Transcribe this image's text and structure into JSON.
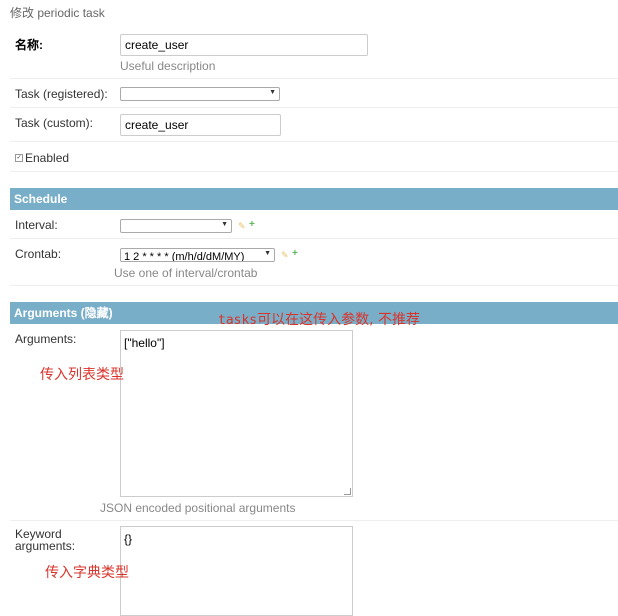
{
  "page": {
    "title": "修改 periodic task"
  },
  "fields": {
    "name": {
      "label": "名称:",
      "value": "create_user",
      "help": "Useful description"
    },
    "task_registered": {
      "label": "Task (registered):",
      "value": ""
    },
    "task_custom": {
      "label": "Task (custom):",
      "value": "create_user"
    },
    "enabled": {
      "label": "Enabled",
      "checked": true
    }
  },
  "schedule": {
    "title": "Schedule",
    "interval": {
      "label": "Interval:",
      "value": ""
    },
    "crontab": {
      "label": "Crontab:",
      "value": "1 2 * * * * (m/h/d/dM/MY)",
      "help": "Use one of interval/crontab"
    }
  },
  "arguments_section": {
    "title": "Arguments (隐藏)",
    "arguments": {
      "label": "Arguments:",
      "value": "[\"hello\"]",
      "help": "JSON encoded positional arguments"
    },
    "kwargs": {
      "label_line1": "Keyword",
      "label_line2": "arguments:",
      "value": "{}"
    }
  },
  "annotations": {
    "tasks_prefix": "tasks",
    "tasks_note": "可以在这传入参数, 不推荐",
    "list_note": "传入列表类型",
    "dict_note": "传入字典类型"
  },
  "icons": {
    "edit": "pencil-icon",
    "add": "plus-icon"
  },
  "colors": {
    "section_bar": "#79aec8",
    "annotation": "#d9342b"
  }
}
